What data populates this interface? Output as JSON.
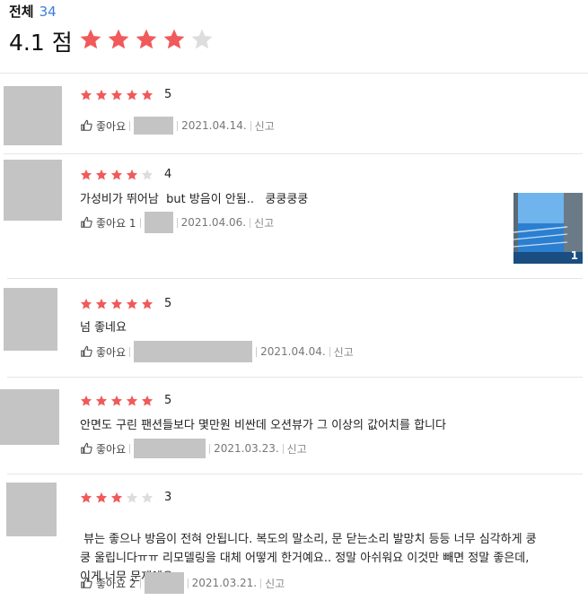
{
  "header": {
    "label": "전체",
    "count": "34",
    "score": "4.1 점",
    "stars_filled": 4
  },
  "reviews": [
    {
      "stars": 5,
      "rating": "5",
      "text": "",
      "like": "좋아요",
      "date": "2021.04.14.",
      "report": "신고"
    },
    {
      "stars": 4,
      "rating": "4",
      "text": "가성비가 뛰어남  but 방음이 안됨..   쿵쿵쿵쿵",
      "like": "좋아요 1",
      "date": "2021.04.06.",
      "report": "신고",
      "photo_count": "1"
    },
    {
      "stars": 5,
      "rating": "5",
      "text": "넘 좋네요",
      "like": "좋아요",
      "date": "2021.04.04.",
      "report": "신고"
    },
    {
      "stars": 5,
      "rating": "5",
      "text": "안면도 구린 팬션들보다 몇만원 비싼데 오션뷰가 그 이상의 값어치를 합니다",
      "like": "좋아요",
      "date": "2021.03.23.",
      "report": "신고"
    },
    {
      "stars": 3,
      "rating": "3",
      "text_lines": [
        " 뷰는 좋으나 방음이 전혀 안됩니다. 복도의 말소리, 문 닫는소리 발망치 등등 너무 심각하게 쿵",
        "쿵 울립니다ㅠㅠ 리모델링을 대체 어떻게 한거예요.. 정말 아쉬워요 이것만 빼면 정말 좋은데,",
        "이게 너무 문제예요."
      ],
      "like": "좋아요 2",
      "date": "2021.03.21.",
      "report": "신고"
    }
  ],
  "colors": {
    "star_on": "#f05a5a",
    "star_off": "#dddddd",
    "accent": "#3b7ddd"
  }
}
